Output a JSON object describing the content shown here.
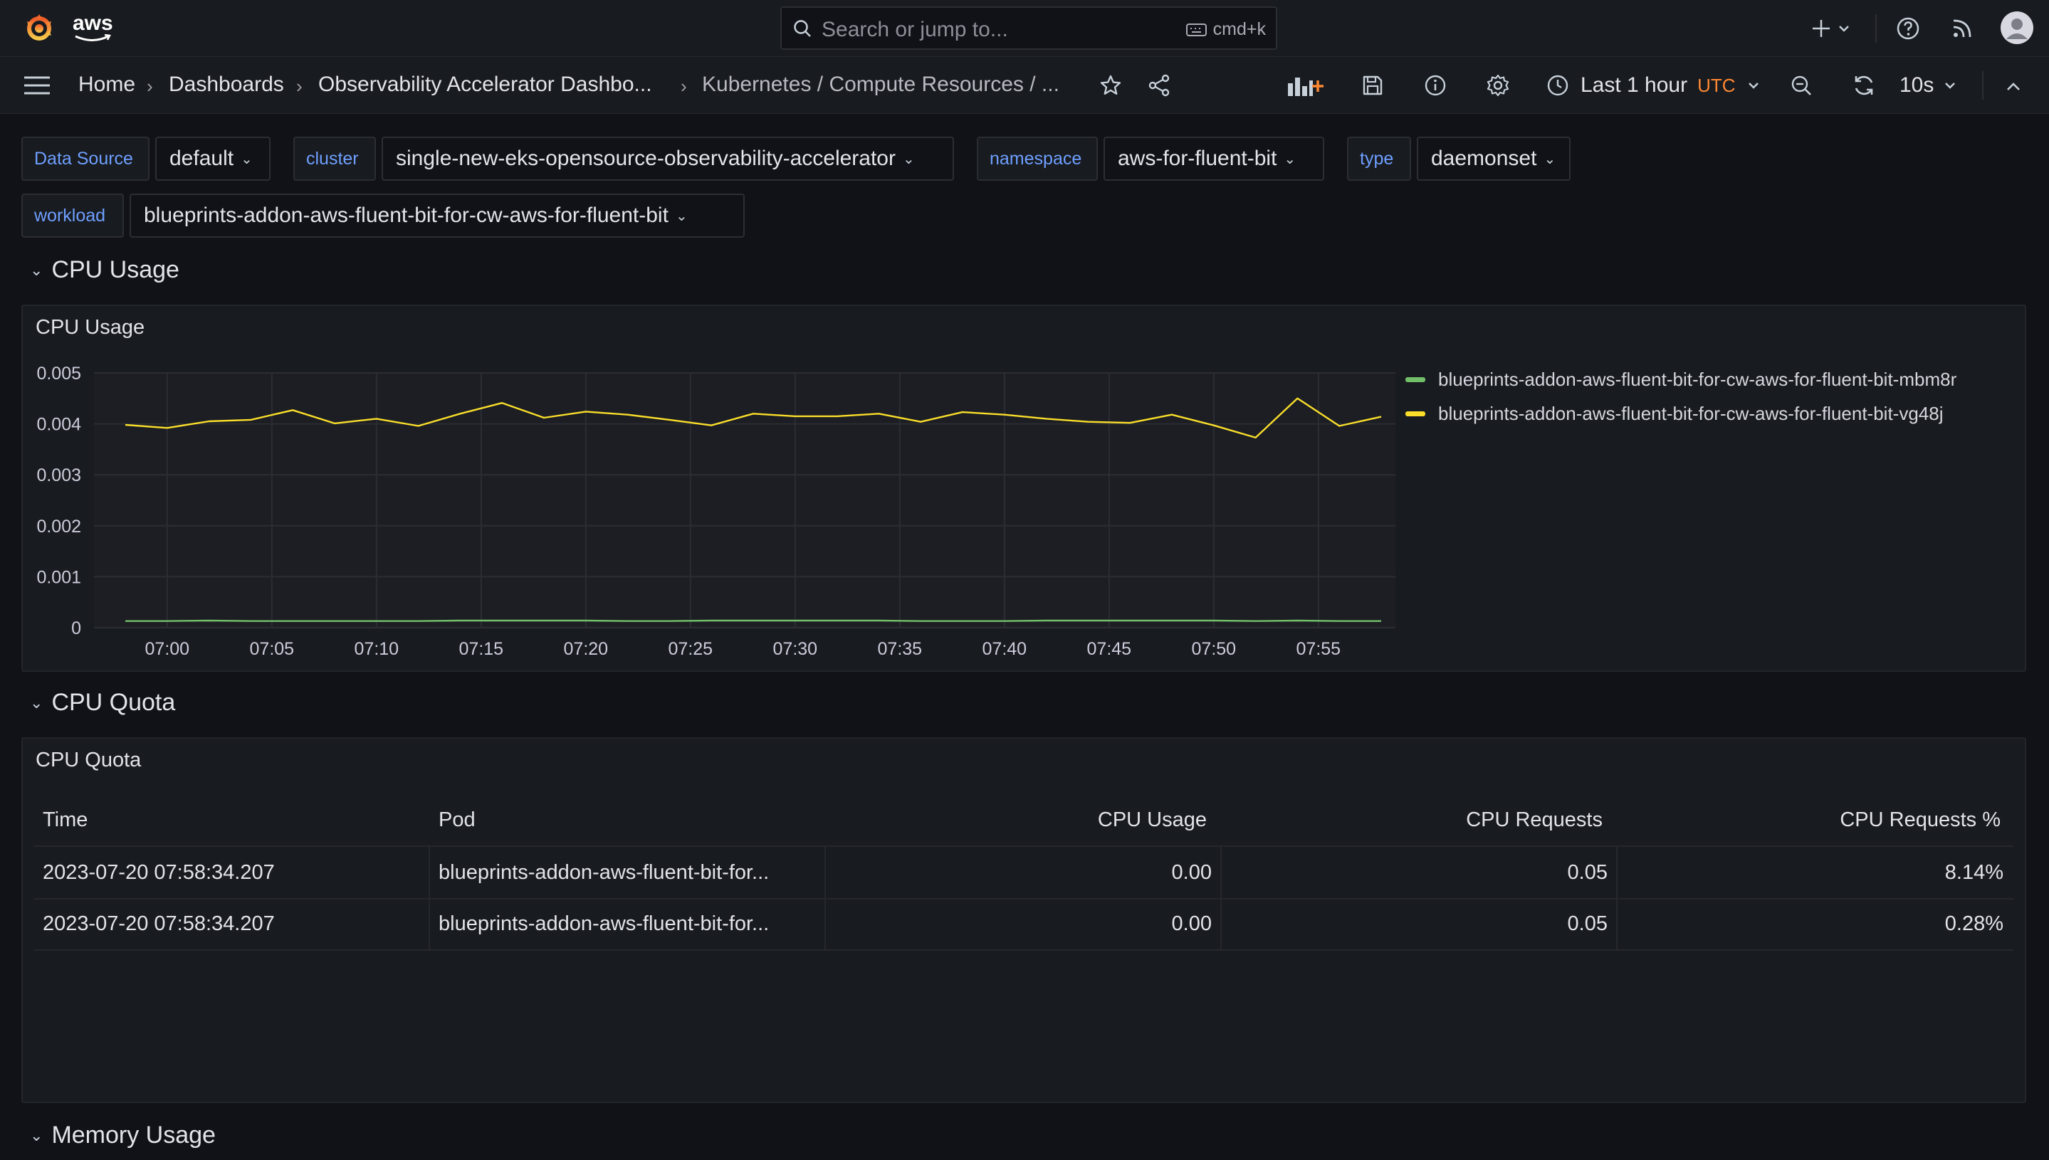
{
  "brand": {
    "aws_text": "aws"
  },
  "search": {
    "placeholder": "Search or jump to...",
    "shortcut": "cmd+k"
  },
  "breadcrumbs": [
    {
      "label": "Home"
    },
    {
      "label": "Dashboards"
    },
    {
      "label": "Observability Accelerator Dashbo..."
    },
    {
      "label": "Kubernetes / Compute Resources / ..."
    }
  ],
  "time_picker": {
    "label": "Last 1 hour",
    "timezone": "UTC"
  },
  "refresh": {
    "interval": "10s"
  },
  "variables": [
    {
      "label": "Data Source",
      "value": "default"
    },
    {
      "label": "cluster",
      "value": "single-new-eks-opensource-observability-accelerator"
    },
    {
      "label": "namespace",
      "value": "aws-for-fluent-bit"
    },
    {
      "label": "type",
      "value": "daemonset"
    },
    {
      "label": "workload",
      "value": "blueprints-addon-aws-fluent-bit-for-cw-aws-for-fluent-bit"
    }
  ],
  "rows": {
    "cpu_usage": "CPU Usage",
    "cpu_quota": "CPU Quota",
    "memory_usage": "Memory Usage"
  },
  "panels": {
    "cpu_usage_title": "CPU Usage",
    "cpu_quota_title": "CPU Quota"
  },
  "colors": {
    "series_green": "#73bf69",
    "series_yellow": "#fade2a",
    "accent_orange": "#ff8833",
    "variable_label_blue": "#6e9fff"
  },
  "chart_data": {
    "type": "line",
    "title": "CPU Usage",
    "x": [
      "06:58",
      "07:00",
      "07:02",
      "07:04",
      "07:06",
      "07:08",
      "07:10",
      "07:12",
      "07:14",
      "07:16",
      "07:18",
      "07:20",
      "07:22",
      "07:24",
      "07:26",
      "07:28",
      "07:30",
      "07:32",
      "07:34",
      "07:36",
      "07:38",
      "07:40",
      "07:42",
      "07:44",
      "07:46",
      "07:48",
      "07:50",
      "07:52",
      "07:54",
      "07:56",
      "07:58"
    ],
    "x_ticks": [
      "07:00",
      "07:05",
      "07:10",
      "07:15",
      "07:20",
      "07:25",
      "07:30",
      "07:35",
      "07:40",
      "07:45",
      "07:50",
      "07:55"
    ],
    "y_ticks": [
      "0",
      "0.001",
      "0.002",
      "0.003",
      "0.004",
      "0.005"
    ],
    "ylim": [
      0,
      0.005
    ],
    "grid": true,
    "legend_position": "right",
    "series": [
      {
        "name": "blueprints-addon-aws-fluent-bit-for-cw-aws-for-fluent-bit-mbm8r",
        "color": "#73bf69",
        "values": [
          0.00013,
          0.00013,
          0.00014,
          0.00013,
          0.00013,
          0.00013,
          0.00013,
          0.00013,
          0.00014,
          0.00014,
          0.00014,
          0.00014,
          0.00013,
          0.00013,
          0.00014,
          0.00014,
          0.00014,
          0.00014,
          0.00014,
          0.00013,
          0.00013,
          0.00013,
          0.00014,
          0.00014,
          0.00014,
          0.00014,
          0.00014,
          0.00013,
          0.00014,
          0.00013,
          0.00013
        ]
      },
      {
        "name": "blueprints-addon-aws-fluent-bit-for-cw-aws-for-fluent-bit-vg48j",
        "color": "#fade2a",
        "values": [
          0.00398,
          0.00392,
          0.00405,
          0.00408,
          0.00427,
          0.00401,
          0.0041,
          0.00396,
          0.0042,
          0.00441,
          0.00412,
          0.00424,
          0.00418,
          0.00408,
          0.00397,
          0.0042,
          0.00415,
          0.00415,
          0.0042,
          0.00404,
          0.00423,
          0.00418,
          0.0041,
          0.00404,
          0.00402,
          0.00418,
          0.00397,
          0.00373,
          0.0045,
          0.00396,
          0.00414
        ]
      }
    ]
  },
  "table": {
    "columns": [
      "Time",
      "Pod",
      "CPU Usage",
      "CPU Requests",
      "CPU Requests %"
    ],
    "rows": [
      [
        "2023-07-20 07:58:34.207",
        "blueprints-addon-aws-fluent-bit-for...",
        "0.00",
        "0.05",
        "8.14%"
      ],
      [
        "2023-07-20 07:58:34.207",
        "blueprints-addon-aws-fluent-bit-for...",
        "0.00",
        "0.05",
        "0.28%"
      ]
    ]
  }
}
